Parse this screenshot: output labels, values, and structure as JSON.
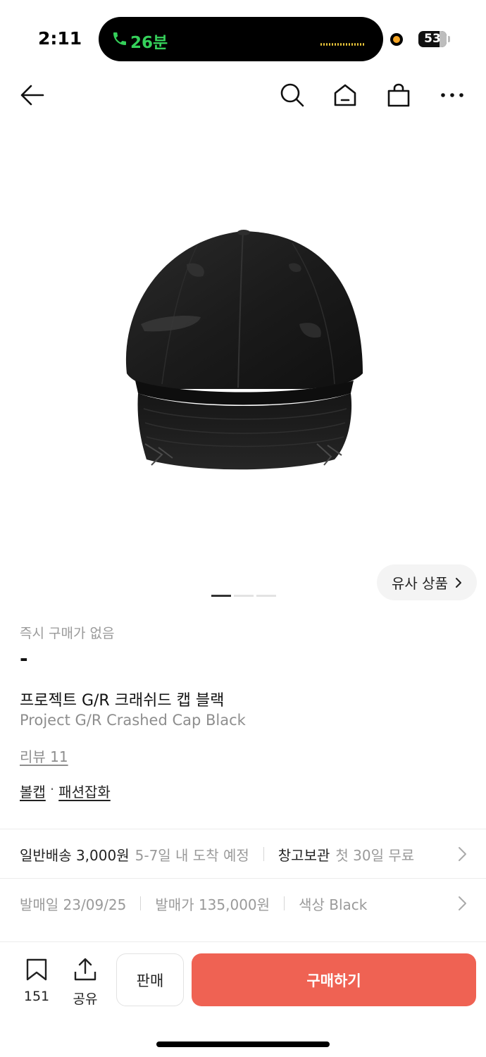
{
  "status_bar": {
    "time": "2:11",
    "call_duration": "26분",
    "battery": "53"
  },
  "nav": {
    "icons": [
      "back-arrow-icon",
      "search-icon",
      "home-icon",
      "shopping-bag-icon",
      "more-icon"
    ]
  },
  "gallery": {
    "similar_label": "유사 상품",
    "page_count": 3,
    "active_page": 1
  },
  "product": {
    "price_label": "즉시 구매가 없음",
    "price_value": "-",
    "name_ko": "프로젝트 G/R 크래쉬드 캡 블랙",
    "name_en": "Project G/R Crashed Cap Black",
    "review": "리뷰 11",
    "category_1": "볼캡",
    "category_sep": "·",
    "category_2": "패션잡화"
  },
  "shipping": {
    "standard_label": "일반배송 3,000원",
    "standard_detail": "5-7일 내 도착 예정",
    "storage_label": "창고보관",
    "storage_detail": "첫 30일 무료"
  },
  "details": {
    "release_date": "발매일 23/09/25",
    "release_price": "발매가 135,000원",
    "color": "색상 Black"
  },
  "bottom_bar": {
    "bookmark_count": "151",
    "share_label": "공유",
    "sell_label": "판매",
    "buy_label": "구매하기"
  },
  "colors": {
    "buy_button": "#ef6253",
    "call_green": "#35d05a"
  }
}
